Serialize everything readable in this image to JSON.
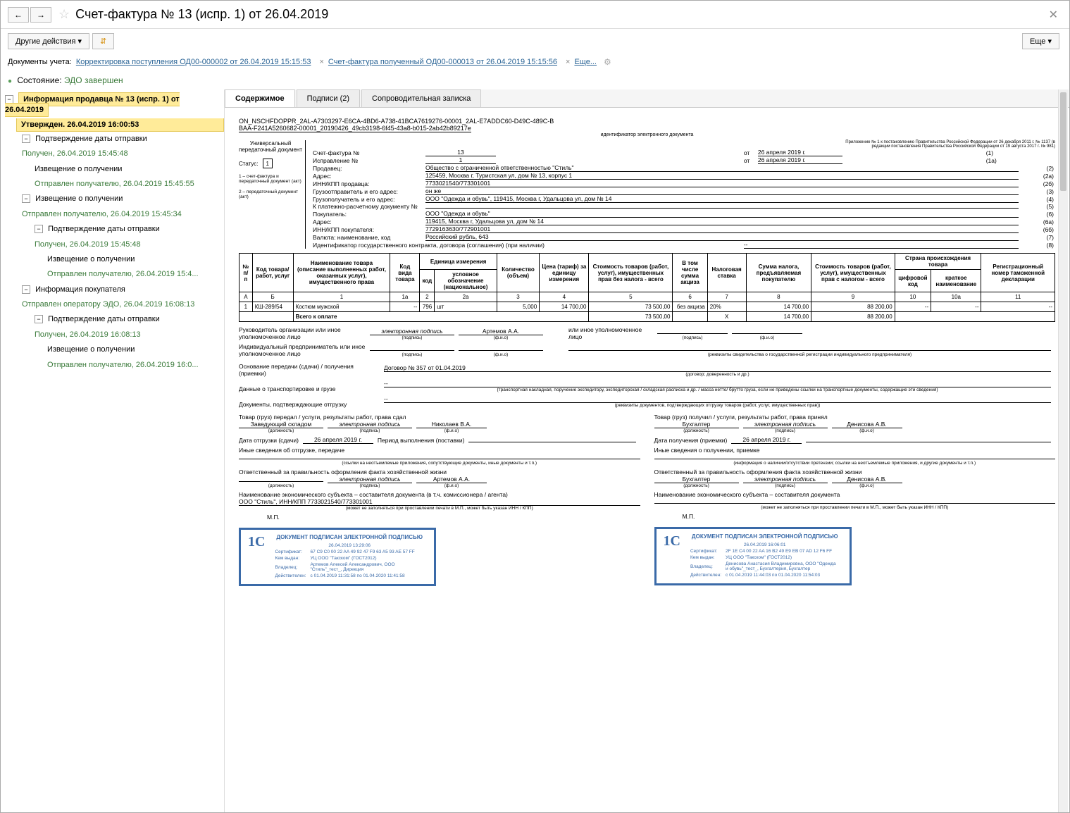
{
  "title": "Счет-фактура № 13 (испр. 1) от 26.04.2019",
  "toolbar": {
    "other": "Другие действия",
    "more": "Еще"
  },
  "docs": {
    "label": "Документы учета:",
    "link1": "Корректировка поступления ОД00-000002 от 26.04.2019 15:15:53",
    "link2": "Счет-фактура полученный ОД00-000013 от 26.04.2019 15:15:56",
    "more": "Еще..."
  },
  "status": {
    "label": "Состояние:",
    "value": "ЭДО завершен"
  },
  "tree": {
    "seller": "Информация продавца № 13 (испр. 1) от 26.04.2019",
    "approved": "Утвержден. 26.04.2019 16:00:53",
    "n1": "Подтверждение даты отправки",
    "n1d": "Получен, 26.04.2019 15:45:48",
    "n11": "Извещение о получении",
    "n11d": "Отправлен получателю, 26.04.2019 15:45:55",
    "n2": "Извещение о получении",
    "n2d": "Отправлен получателю, 26.04.2019 15:45:34",
    "n21": "Подтверждение даты отправки",
    "n21d": "Получен, 26.04.2019 15:45:48",
    "n211": "Извещение о получении",
    "n211d": "Отправлен получателю, 26.04.2019 15:4...",
    "n3": "Информация покупателя",
    "n3d": "Отправлен оператору ЭДО, 26.04.2019 16:08:13",
    "n31": "Подтверждение даты отправки",
    "n31d": "Получен, 26.04.2019 16:08:13",
    "n311": "Извещение о получении",
    "n311d": "Отправлен получателю, 26.04.2019 16:0..."
  },
  "tabs": {
    "t1": "Содержимое",
    "t2": "Подписи (2)",
    "t3": "Сопроводительная записка"
  },
  "file": {
    "id": "ON_NSCHFDOPPR_2AL-A7303297-E6CA-4BD6-A738-41BCA7619276-00001_2AL-E7ADDC60-D49C-489C-B",
    "id2": "BAA-F241A5260682-00001_20190426_49cb3198-6f45-43a8-b015-2ab42b89217e",
    "idsub": "идентификатор электронного документа"
  },
  "upd": {
    "univ": "Универсальный передаточный документ",
    "statusLbl": "Статус:",
    "statusVal": "1",
    "tinyLine1": "1 – счет-фактура и передаточный документ (акт)",
    "tinyLine2": "2 – передаточный документ (акт)",
    "rightNote": "Приложение № 1 к постановлению Правительства Российской Федерации от 26 декабря 2011 г. № 1137 (в редакции постановления Правительства Российской Федерации от 19 августа 2017 г. № 981)"
  },
  "fields": {
    "sf": "Счет-фактура №",
    "sfVal": "13",
    "ot": "от",
    "sfDate": "26 апреля 2019 г.",
    "sfTail": "(1)",
    "isp": "Исправление №",
    "ispVal": "1",
    "ispDate": "26 апреля 2019 г.",
    "ispTail": "(1а)",
    "seller": "Продавец:",
    "sellerVal": "Общество с ограниченной ответственностью \"Стиль\"",
    "sellerTail": "(2)",
    "addr": "Адрес:",
    "addrVal": "125459, Москва г, Туристская ул, дом № 13, корпус 1",
    "addrTail": "(2а)",
    "innkpp": "ИНН/КПП продавца:",
    "innkppVal": "7733021540/773301001",
    "innkppTail": "(2б)",
    "shipper": "Грузоотправитель и его адрес:",
    "shipperVal": "он же",
    "shipperTail": "(3)",
    "consignee": "Грузополучатель и его адрес:",
    "consigneeVal": "ООО \"Одежда и обувь\", 119415, Москва г, Удальцова ул, дом № 14",
    "consigneeTail": "(4)",
    "payDoc": "К платежно-расчетному документу №",
    "payDocVal": "",
    "payDocTail": "(5)",
    "buyer": "Покупатель:",
    "buyerVal": "ООО \"Одежда и обувь\"",
    "buyerTail": "(6)",
    "buyerAddr": "Адрес:",
    "buyerAddrVal": "119415, Москва г, Удальцова ул, дом № 14",
    "buyerAddrTail": "(6а)",
    "buyerInn": "ИНН/КПП покупателя:",
    "buyerInnVal": "7729163630/772901001",
    "buyerInnTail": "(6б)",
    "currency": "Валюта: наименование, код",
    "currencyVal": "Российский рубль, 643",
    "currencyTail": "(7)",
    "gosid": "Идентификатор государственного контракта, договора (соглашения) (при наличии)",
    "gosidVal": "--",
    "gosidTail": "(8)"
  },
  "table": {
    "h_np": "№ п/п",
    "h_code": "Код товара/ работ, услуг",
    "h_name": "Наименование товара (описание выполненных работ, оказанных услуг), имущественного права",
    "h_kind": "Код вида товара",
    "h_unit": "Единица измерения",
    "h_unit_code": "код",
    "h_unit_name": "условное обозначение (национальное)",
    "h_qty": "Количество (объем)",
    "h_price": "Цена (тариф) за единицу измерения",
    "h_sum_no_tax": "Стоимость товаров (работ, услуг), имущественных прав без налога - всего",
    "h_aktsiz": "В том числе сумма акциза",
    "h_tax_rate": "Налоговая ставка",
    "h_tax_sum": "Сумма налога, предъявляемая покупателю",
    "h_sum_tax": "Стоимость товаров (работ, услуг), имущественных прав с налогом - всего",
    "h_country": "Страна происхождения товара",
    "h_country_code": "цифровой код",
    "h_country_name": "краткое наименование",
    "h_reg": "Регистрационный номер таможенной декларации",
    "row_a": "А",
    "row_b": "Б",
    "row_1": "1",
    "row_1a": "1а",
    "row_2": "2",
    "row_2a": "2а",
    "row_3": "3",
    "row_4": "4",
    "row_5": "5",
    "row_6": "6",
    "row_7": "7",
    "row_8": "8",
    "row_9": "9",
    "row_10": "10",
    "row_10a": "10а",
    "row_11": "11",
    "r1_n": "1",
    "r1_code": "КШ-289/54",
    "r1_name": "Костюм мужской",
    "r1_kind": "--",
    "r1_unit_code": "796",
    "r1_unit_name": "шт",
    "r1_qty": "5,000",
    "r1_price": "14 700,00",
    "r1_sum_no": "73 500,00",
    "r1_aktsiz": "без акциза",
    "r1_rate": "20%",
    "r1_tax": "14 700,00",
    "r1_sum": "88 200,00",
    "r1_cc": "--",
    "r1_cn": "--",
    "r1_reg": "--",
    "total": "Всего к оплате",
    "total_sum_no": "73 500,00",
    "total_x": "X",
    "total_tax": "14 700,00",
    "total_sum": "88 200,00"
  },
  "sig": {
    "head": "Руководитель организации или иное уполномоченное лицо",
    "esig": "электронная подпись",
    "artemov": "Артемов А.А.",
    "other_head": "или иное уполномоченное лицо",
    "ip": "Индивидуальный предприниматель или иное уполномоченное лицо",
    "podpis_tiny": "(подпись)",
    "fio_tiny": "(ф.и.о)",
    "rekv_tiny": "(реквизиты свидетельства о государственной регистрации индивидуального предпринимателя)",
    "basis": "Основание передачи (сдачи) / получения (приемки)",
    "basisVal": "Договор № 357 от 01.04.2019",
    "basisSub": "(договор; доверенность и др.)",
    "transport": "Данные о транспортировке и грузе",
    "transportVal": "--",
    "transportSub": "(транспортная накладная, поручение экспедитору, экспедиторская / складская расписка и др. / масса нетто/ брутто груза, если не приведены ссылки на транспортные документы, содержащие эти сведения)",
    "confirm": "Документы, подтверждающие отгрузку",
    "confirmVal": "--",
    "confirmSub": "(реквизиты документов, подтверждающих отгрузку товаров (работ, услуг, имущественных прав))",
    "left_title": "Товар (груз) передал / услуги, результаты работ, права сдал",
    "left_pos": "Заведующий складом",
    "left_name": "Николаев В.А.",
    "left_date_lbl": "Дата отгрузки (сдачи)",
    "left_date": "26 апреля 2019 г.",
    "left_period": "Период выполнения (поставки)",
    "left_other": "Иные сведения об отгрузке, передаче",
    "left_other_sub": "(ссылки на неотъемлемые приложения, сопутствующие документы, иные документы и т.п.)",
    "left_resp": "Ответственный за правильность оформления факта хозяйственной жизни",
    "left_org": "Наименование экономического субъекта – составителя документа (в т.ч. комиссионера / агента)",
    "left_org_val": "ООО \"Стиль\", ИНН/КПП 7733021540/773301001",
    "org_sub": "(может не заполняться при проставлении печати в М.П., может быть указан ИНН / КПП)",
    "right_title": "Товар (груз) получил / услуги, результаты работ, права принял",
    "right_pos": "Бухгалтер",
    "right_name": "Денисова А.В.",
    "right_date_lbl": "Дата получения (приемки)",
    "right_date": "26 апреля 2019 г.",
    "right_other": "Иные сведения о получении, приемке",
    "right_other_sub": "(информация о наличии/отсутствии претензии; ссылки на неотъемлемые приложения, и другие документы и т.п.)",
    "right_resp": "Ответственный за правильность оформления факта хозяйственной жизни",
    "right_org": "Наименование экономического субъекта – составителя документа",
    "mp": "М.П.",
    "dolzh_sub": "(должность)"
  },
  "stamp1": {
    "title": "ДОКУМЕНТ ПОДПИСАН ЭЛЕКТРОННОЙ ПОДПИСЬЮ",
    "date": "26.04.2019 13:29:06",
    "certLbl": "Сертификат:",
    "cert": "67 C9 C0 00 22 AA 49 92 47 F9 63 A5 93 AE 57 FF",
    "issuedLbl": "Кем выдан:",
    "issued": "УЦ ООО \"Такском\" (ГОСТ2012)",
    "ownerLbl": "Владелец:",
    "owner": "Артемов Алексей Александрович, ООО \"Стиль\"_тест_, Дирекция",
    "validLbl": "Действителен:",
    "valid": "с 01.04.2019 11:31:58 по 01.04.2020 11:41:58"
  },
  "stamp2": {
    "title": "ДОКУМЕНТ ПОДПИСАН ЭЛЕКТРОННОЙ ПОДПИСЬЮ",
    "date": "26.04.2019 16:06:01",
    "certLbl": "Сертификат:",
    "cert": "2F 1E C4 00 22 AA 16 B2 49 E9 EB 07 AD 12 F6 FF",
    "issuedLbl": "Кем выдан:",
    "issued": "УЦ ООО \"Такском\" (ГОСТ2012)",
    "ownerLbl": "Владелец:",
    "owner": "Денисова Анастасия Владимировна, ООО \"Одежда и обувь\"_тест_, Бухгалтерия, Бухгалтер",
    "validLbl": "Действителен:",
    "valid": "с 01.04.2019 11:44:03 по 01.04.2020 11:54:03"
  }
}
